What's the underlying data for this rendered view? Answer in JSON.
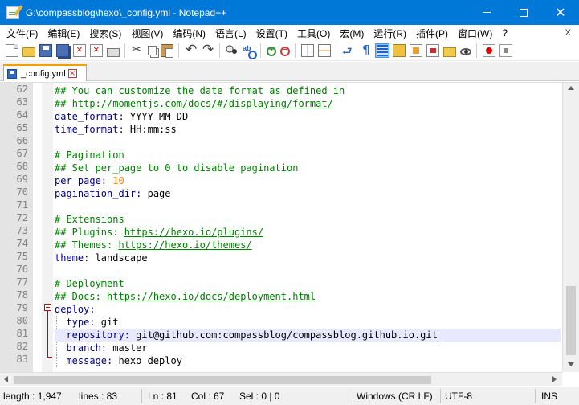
{
  "window": {
    "title": "G:\\compassblog\\hexo\\_config.yml - Notepad++",
    "minimize_glyph": "",
    "close_glyph": "✕"
  },
  "menu": {
    "items": [
      "文件(F)",
      "编辑(E)",
      "搜索(S)",
      "视图(V)",
      "编码(N)",
      "语言(L)",
      "设置(T)",
      "工具(O)",
      "宏(M)",
      "运行(R)",
      "插件(P)",
      "窗口(W)",
      "?"
    ],
    "close_doc": "X"
  },
  "tab": {
    "label": "_config.yml",
    "close": "×"
  },
  "editor": {
    "line_numbers": [
      "62",
      "63",
      "64",
      "65",
      "66",
      "67",
      "68",
      "69",
      "70",
      "71",
      "72",
      "73",
      "74",
      "75",
      "76",
      "77",
      "78",
      "79",
      "80",
      "81",
      "82",
      "83"
    ],
    "lines": {
      "l62": "## You can customize the date format as defined in",
      "l63_prefix": "## ",
      "l63_url": "http://momentjs.com/docs/#/displaying/format/",
      "l64_key": "date_format:",
      "l64_val": " YYYY-MM-DD",
      "l65_key": "time_format:",
      "l65_val": " HH:mm:ss",
      "l67": "# Pagination",
      "l68": "## Set per_page to 0 to disable pagination",
      "l69_key": "per_page:",
      "l69_val": " 10",
      "l70_key": "pagination_dir:",
      "l70_val": " page",
      "l72": "# Extensions",
      "l73_prefix": "## Plugins: ",
      "l73_url": "https://hexo.io/plugins/",
      "l74_prefix": "## Themes: ",
      "l74_url": "https://hexo.io/themes/",
      "l75_key": "theme:",
      "l75_val": " landscape",
      "l77": "# Deployment",
      "l78_prefix": "## Docs: ",
      "l78_url": "https://hexo.io/docs/deployment.html",
      "l79_key": "deploy:",
      "l80_key": "type:",
      "l80_val": " git",
      "l81_key": "repository:",
      "l81_val": " git@github.com:compassblog/compassblog.github.io.git",
      "l82_key": "branch:",
      "l82_val": " master",
      "l83_key": "message:",
      "l83_val": " hexo deploy"
    },
    "current_line": "81"
  },
  "status": {
    "length": "length : 1,947",
    "lines": "lines : 83",
    "ln": "Ln : 81",
    "col": "Col : 67",
    "sel": "Sel : 0 | 0",
    "eol": "Windows (CR LF)",
    "encoding": "UTF-8",
    "mode": "INS"
  },
  "colors": {
    "titlebar": "#0078d7",
    "comment": "#008000",
    "key": "#000080",
    "number": "#ff8000",
    "current_line": "#e8e8ff",
    "tab_accent": "#f0a000"
  }
}
